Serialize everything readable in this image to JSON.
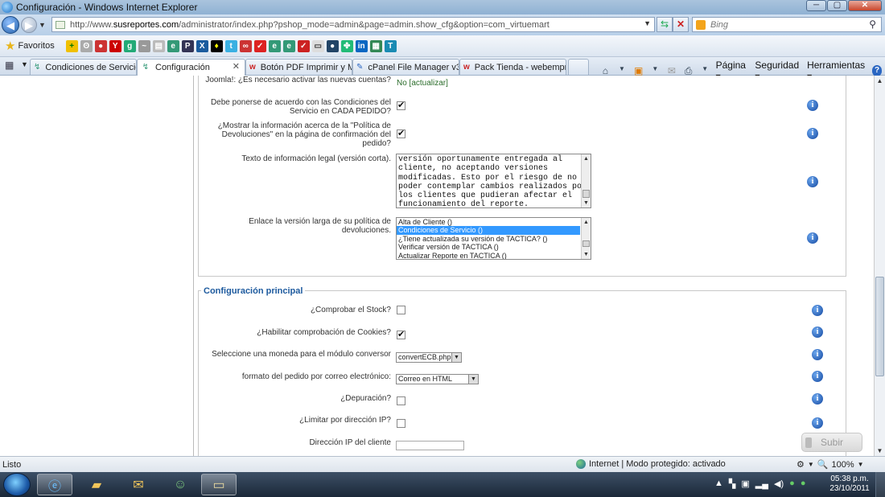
{
  "window": {
    "title": "Configuración - Windows Internet Explorer",
    "minimize": "─",
    "maximize": "▢",
    "close": "✕"
  },
  "address": {
    "url_prefix": "http://www.",
    "url_host": "susreportes.com",
    "url_path": "/administrator/index.php?pshop_mode=admin&page=admin.show_cfg&option=com_virtuemart",
    "search_placeholder": "Bing"
  },
  "favorites": {
    "label": "Favoritos"
  },
  "tabs": [
    {
      "label": "Condiciones de Servicio ..."
    },
    {
      "label": "Configuración"
    },
    {
      "label": "Botón PDF Imprimir y M..."
    },
    {
      "label": "cPanel File Manager v3"
    },
    {
      "label": "Pack Tienda - webempr..."
    }
  ],
  "commandbar": {
    "page": "Página",
    "security": "Seguridad",
    "tools": "Herramientas"
  },
  "section1": {
    "row0": {
      "label": "Joomla!: ¿Es necesario activar las nuevas cuentas?",
      "value": "No [actualizar]"
    },
    "row1": {
      "label_line1": "Debe ponerse de acuerdo con las Condiciones del",
      "label_line2": "Servicio en CADA PEDIDO?",
      "checked": true
    },
    "row2": {
      "label_line1": "¿Mostrar la información acerca de la \"Política de",
      "label_line2": "Devoluciones\" en la página de confirmación del",
      "label_line3": "pedido?",
      "checked": true
    },
    "row3": {
      "label": "Texto de información legal (versión corta).",
      "text": "versión oportunamente entregada al\ncliente, no aceptando versiones\nmodificadas. Esto por el riesgo de no\npoder contemplar cambios realizados por\nlos clientes que pudieran afectar el\nfuncionamiento del reporte."
    },
    "row4": {
      "label_line1": "Enlace la versión larga de su política de",
      "label_line2": "devoluciones.",
      "options": [
        "Alta de Cliente ()",
        "Condiciones de Servicio ()",
        "¿Tiene actualizada su versión de TACTICA? ()",
        "Verificar versión de TACTICA ()",
        "Actualizar Reporte en TACTICA ()"
      ],
      "selected_index": 1
    }
  },
  "section2": {
    "legend": "Configuración principal",
    "stock": {
      "label": "¿Comprobar el Stock?",
      "checked": false
    },
    "cookies": {
      "label": "¿Habilitar comprobación de Cookies?",
      "checked": true
    },
    "currency": {
      "label": "Seleccione una moneda para el módulo conversor",
      "value": "convertECB.php"
    },
    "email_format": {
      "label": "formato del pedido por correo electrónico:",
      "value": "Correo en HTML"
    },
    "debug": {
      "label": "¿Depuración?",
      "checked": false
    },
    "ip_limit": {
      "label": "¿Limitar por dirección IP?",
      "checked": false
    },
    "client_ip": {
      "label": "Dirección IP del cliente",
      "value": ""
    }
  },
  "submit_label": "Subir",
  "status": {
    "text": "Listo",
    "zone": "Internet | Modo protegido: activado",
    "zoom": "100%"
  },
  "clock": {
    "time": "05:38 p.m.",
    "date": "23/10/2011"
  },
  "colors": {
    "legend": "#1d5a9e",
    "link": "#2a6c2a",
    "selected_option": "#3399ff",
    "info_icon": "#1448a0"
  }
}
